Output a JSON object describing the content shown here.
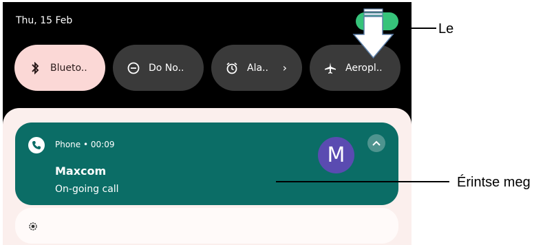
{
  "status": {
    "date": "Thu, 15 Feb"
  },
  "tiles": [
    {
      "label": "Blueto..",
      "icon": "bluetooth-icon",
      "state": "on"
    },
    {
      "label": "Do No..",
      "icon": "do-not-disturb-icon",
      "state": "off"
    },
    {
      "label": "Ala..",
      "icon": "alarm-icon",
      "state": "off",
      "chevron": "›"
    },
    {
      "label": "Aeropl..",
      "icon": "airplane-icon",
      "state": "off"
    }
  ],
  "notification": {
    "app": "Phone",
    "time": "Phone • 00:09",
    "title": "Maxcom",
    "text": "On-going call",
    "avatar_letter": "M"
  },
  "annotations": {
    "swipe": "Le",
    "tap": "Érintse meg"
  },
  "colors": {
    "notification_bg": "#0b6d66",
    "active_tile": "#fbd8d6",
    "inactive_tile": "#3a3a3a",
    "avatar": "#5a4bb1",
    "toggle": "#36c37a"
  }
}
